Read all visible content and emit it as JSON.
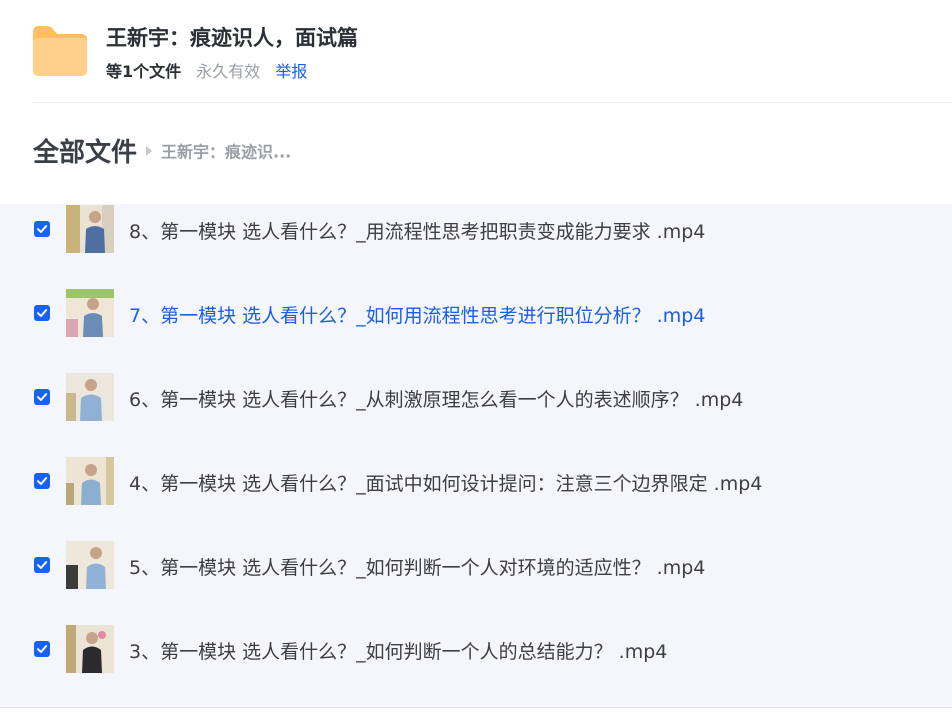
{
  "share": {
    "title": "王新宇：痕迹识人，面试篇",
    "file_count": "等1个文件",
    "validity": "永久有效",
    "report": "举报",
    "folder_icon": "folder-icon"
  },
  "breadcrumb": {
    "root": "全部文件",
    "current": "王新宇：痕迹识..."
  },
  "colors": {
    "accent": "#1a5fe6",
    "checkbox": "#1762ee",
    "folder": "#ffc46b",
    "list_bg": "#f5f6fc"
  },
  "files": [
    {
      "name": "8、第一模块 选人看什么？_用流程性思考把职责变成能力要求 .mp4",
      "checked": true,
      "active": false
    },
    {
      "name": "7、第一模块 选人看什么？_如何用流程性思考进行职位分析？ .mp4",
      "checked": true,
      "active": true
    },
    {
      "name": "6、第一模块 选人看什么？_从刺激原理怎么看一个人的表述顺序？ .mp4",
      "checked": true,
      "active": false
    },
    {
      "name": "4、第一模块 选人看什么？_面试中如何设计提问：注意三个边界限定 .mp4",
      "checked": true,
      "active": false
    },
    {
      "name": "5、第一模块 选人看什么？_如何判断一个人对环境的适应性？ .mp4",
      "checked": true,
      "active": false
    },
    {
      "name": "3、第一模块 选人看什么？_如何判断一个人的总结能力？ .mp4",
      "checked": true,
      "active": false
    }
  ]
}
